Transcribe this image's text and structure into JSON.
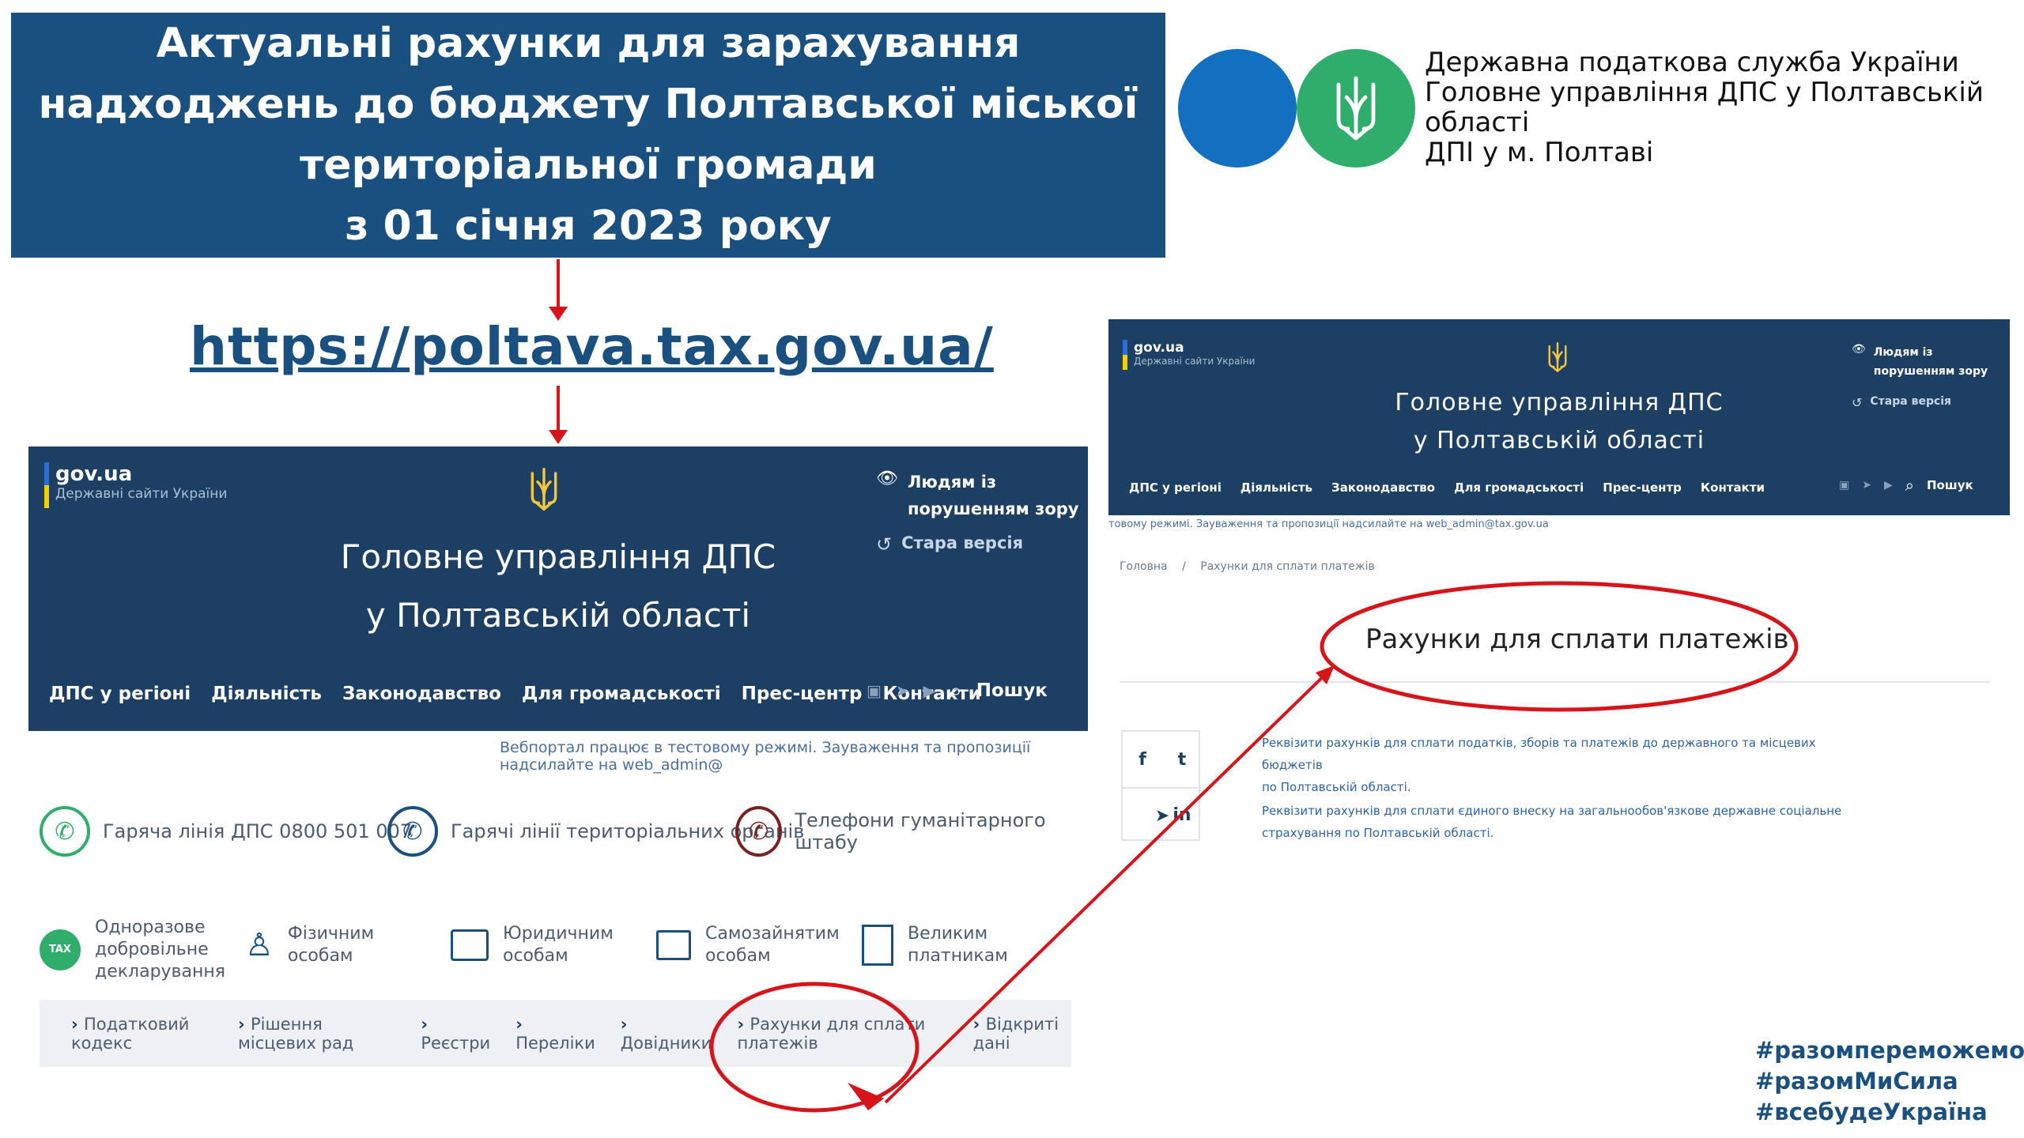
{
  "banner": {
    "lines": [
      "Актуальні рахунки для зарахування",
      "надходжень до бюджету Полтавської міської",
      "територіальної громади",
      "з 01 січня 2023 року"
    ]
  },
  "org": {
    "lines": [
      "Державна податкова служба України",
      "Головне управління ДПС у Полтавській",
      "області",
      "ДПІ у м. Полтаві"
    ]
  },
  "url": "https://poltava.tax.gov.ua/",
  "colors": {
    "banner": "#1a5080",
    "header": "#1d3f63",
    "red": "#d8141b",
    "green": "#2fae6b",
    "blue": "#1370c0"
  },
  "site": {
    "gov_title": "gov.ua",
    "gov_sub": "Державні сайти України",
    "title_line1": "Головне управління ДПС",
    "title_line2": "у Полтавській області",
    "accessibility": "Людям із порушенням зору",
    "accessibility_l1": "Людям із",
    "accessibility_l2": "порушенням зору",
    "old_version": "Стара версія",
    "nav": [
      "ДПС у регіоні",
      "Діяльність",
      "Законодавство",
      "Для громадськості",
      "Прес-центр",
      "Контакти"
    ],
    "search": "Пошук",
    "notice_left": "Вебпортал працює в тестовому режимі. Зауваження та пропозиції надсилайте на web_admin@",
    "notice_right": "товому режимі. Зауваження та пропозиції надсилайте на web_admin@tax.gov.ua"
  },
  "contacts": [
    {
      "label": "Гаряча лінія ДПС",
      "number": "0800 501 007",
      "icon": "phone-icon",
      "color": "#2fae6b"
    },
    {
      "label": "Гарячі лінії територіальних органів",
      "icon": "phone-icon",
      "color": "#1a5080"
    },
    {
      "label": "Телефони гуманітарного штабу",
      "icon": "phone-icon",
      "color": "#7a1f22"
    }
  ],
  "categories": [
    {
      "l1": "Одноразове",
      "l2": "добровільне",
      "l3": "декларування",
      "icon": "tax-arrow-icon"
    },
    {
      "l1": "Фізичним",
      "l2": "особам",
      "icon": "person-icon"
    },
    {
      "l1": "Юридичним",
      "l2": "особам",
      "icon": "briefcase-icon"
    },
    {
      "l1": "Самозайнятим",
      "l2": "особам",
      "icon": "folder-icon"
    },
    {
      "l1": "Великим",
      "l2": "платникам",
      "icon": "building-icon"
    }
  ],
  "tax_badge": "TAX",
  "crumbs": [
    "Податковий кодекс",
    "Рішення місцевих рад",
    "Реєстри",
    "Переліки",
    "Довідники",
    "Рахунки для сплати платежів",
    "Відкриті дані"
  ],
  "right": {
    "breadcrumb_home": "Головна",
    "breadcrumb_sep": "/",
    "breadcrumb_current": "Рахунки для сплати платежів",
    "page_title": "Рахунки для сплати платежів",
    "link1_l1": "Реквізити рахунків для сплати податків, зборів та платежів до державного та місцевих бюджетів",
    "link1_l2": "по Полтавській області.",
    "link2_l1": "Реквізити рахунків для сплати єдиного внеску на загальнообов'язкове державне соціальне",
    "link2_l2": "страхування по Полтавській області.",
    "social": [
      "f",
      "t",
      "in"
    ]
  },
  "hashtags": [
    "#разомпереможемо",
    "#разомМиСила",
    "#всебудеУкраїна"
  ]
}
